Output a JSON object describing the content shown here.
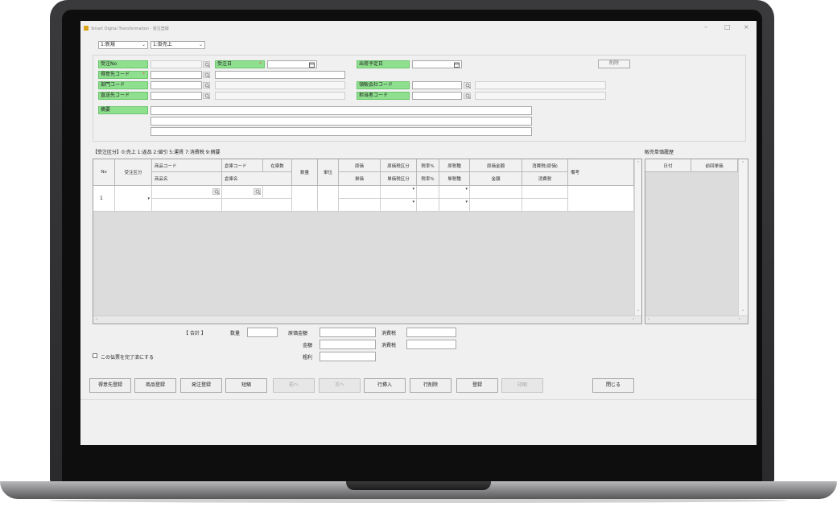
{
  "window": {
    "title": "Smart Digital Transformation  ·  受注登録",
    "controls": {
      "minimize": "–",
      "maximize": "□",
      "close": "×"
    }
  },
  "toolbar": {
    "mode_select": "1:新規",
    "type_select": "1:掛売上"
  },
  "header": {
    "order_no_label": "受注No",
    "order_date_label": "受注日",
    "ship_date_label": "出荷予定日",
    "delete_button": "削除",
    "customer_code_label": "得意先コード",
    "department_code_label": "部門コード",
    "billing_company_label": "領販会社コード",
    "delivery_code_label": "直送先コード",
    "staff_code_label": "担当者コード",
    "summary_label": "摘要",
    "required_mark": "*",
    "calendar_icon": "calendar-icon",
    "search_icon": "search-icon"
  },
  "legend_text": "【受注区分】0:売上 1:返品 2:値引 5:運賃 7:消費税 9:摘要",
  "table": {
    "headers_top": [
      "No",
      "受注区分",
      "商品コード",
      "倉庫コード",
      "在庫数",
      "数量",
      "単位",
      "原価",
      "原価税区分",
      "税率%",
      "原税種",
      "原価金額",
      "消費税(原価)",
      "備考"
    ],
    "headers_bottom": [
      "商品名",
      "倉庫名",
      "単価",
      "単価税区分",
      "税率%",
      "単税種",
      "金額",
      "消費税"
    ],
    "rows": [
      {
        "no": "1",
        "order_type": "",
        "product_code": "",
        "warehouse_code": "",
        "stock": "",
        "qty": "",
        "unit": "",
        "cost": "",
        "remarks": ""
      }
    ],
    "dropdown_glyph": "▾"
  },
  "history": {
    "title": "販売単価履歴",
    "headers": [
      "日付",
      "前回単価"
    ]
  },
  "totals": {
    "total_label": "【 合計 】",
    "qty_label": "数量",
    "cost_amount_label": "原価金額",
    "amount_label": "金額",
    "gross_profit_label": "粗利",
    "tax_label_1": "消費税",
    "tax_label_2": "消費税"
  },
  "complete_checkbox_label": "この伝票を完了済にする",
  "footer_buttons": [
    {
      "label": "得意先登録",
      "enabled": true
    },
    {
      "label": "商品登録",
      "enabled": true
    },
    {
      "label": "発注登録",
      "enabled": true
    },
    {
      "label": "短縮",
      "enabled": true
    },
    {
      "label": "前へ",
      "enabled": false
    },
    {
      "label": "次へ",
      "enabled": false
    },
    {
      "label": "行挿入",
      "enabled": true
    },
    {
      "label": "行削除",
      "enabled": true
    },
    {
      "label": "登録",
      "enabled": true
    },
    {
      "label": "印刷",
      "enabled": false
    },
    {
      "label": "閉じる",
      "enabled": true
    }
  ],
  "colors": {
    "label_green": "#8ee08e",
    "required_red": "#e25b5b",
    "window_bg": "#f0f0f0"
  }
}
